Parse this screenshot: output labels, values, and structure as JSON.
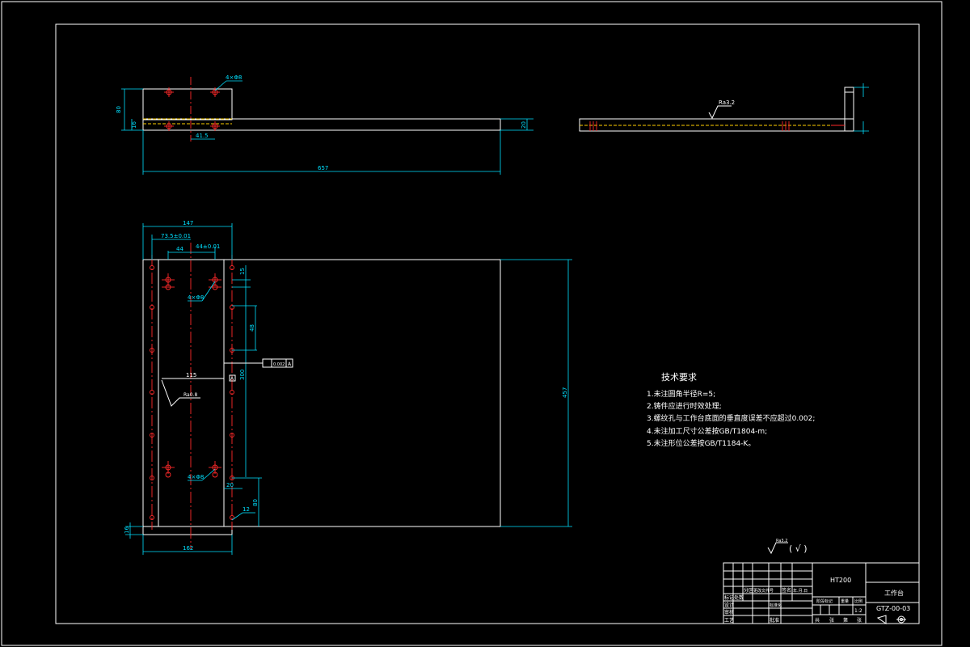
{
  "drawing": {
    "dims": {
      "top_holes": "4×Φ8",
      "top_h": "80",
      "top_t": "16",
      "top_spacing": "41.5",
      "top_len": "657",
      "top_right": "20",
      "w147": "147",
      "w73": "73.5±0.01",
      "w44a": "44",
      "w44b": "44±0.01",
      "holes_a": "4×Φ8",
      "holes_b": "4×Φ8",
      "v15": "15",
      "v48": "48",
      "v300": "300",
      "w115": "115",
      "h457": "457",
      "w20": "20",
      "v80": "80",
      "v12": "12",
      "b16": "16",
      "b162": "162"
    },
    "tolerance": {
      "value": "0.002",
      "datum": "A",
      "box": "A"
    },
    "roughness": {
      "side": "Ra3.2",
      "plan": "Ra0.8",
      "general": "Ra3.2",
      "general_suffix": "( √ )"
    }
  },
  "tech": {
    "title": "技术要求",
    "items": [
      "1.未注圆角半径R=5;",
      "2.铸件应进行时效处理;",
      "3.螺纹孔与工作台底面的垂直度误差不应超过0.002;",
      "4.未注加工尺寸公差按GB/T1804-m;",
      "5.未注形位公差按GB/T1184-K。"
    ]
  },
  "title_block": {
    "material": "HT200",
    "part_name": "工作台",
    "drawing_no": "GTZ-00-03",
    "scale": "1:2",
    "row_labels": [
      "标记",
      "处数",
      "分区",
      "更改文件号",
      "签名",
      "年.月.日"
    ],
    "col_labels": [
      "阶段标记",
      "重量",
      "比例"
    ],
    "sign_labels": [
      "设计",
      "标准化",
      "审核",
      "工艺",
      "批准"
    ],
    "sheet_labels": [
      "共",
      "张",
      "第",
      "张"
    ]
  }
}
